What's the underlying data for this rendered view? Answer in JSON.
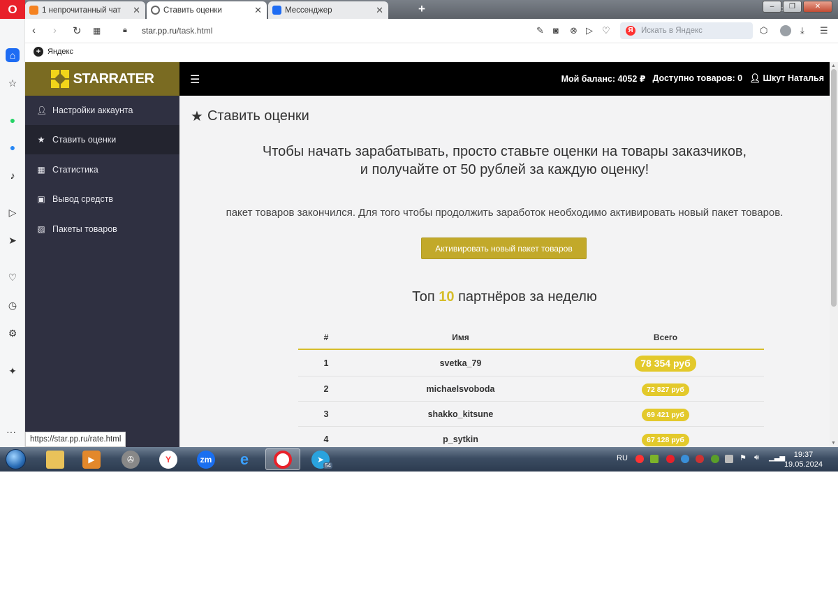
{
  "browser": {
    "tabs": [
      {
        "label": "1 непрочитанный чат",
        "icon": "chat-icon",
        "color": "#f58220"
      },
      {
        "label": "Ставить оценки",
        "icon": "globe-icon",
        "color": "#666666"
      },
      {
        "label": "Мессенджер",
        "icon": "messenger-icon",
        "color": "#1e6cf3"
      }
    ],
    "url_host": "star.pp.ru",
    "url_path": "/task.html",
    "search_placeholder": "Искать в Яндекс",
    "bookmark": "Яндекс",
    "status_url": "https://star.pp.ru/rate.html"
  },
  "brand": {
    "name": "STARRATER",
    "color": "#7a6b22",
    "accent": "#f2d51a"
  },
  "topbar": {
    "balance": "Мой баланс: 4052 ₽",
    "available": "Доступно товаров: 0",
    "user": "Шкут Наталья"
  },
  "sidebar": {
    "items": [
      {
        "label": "Настройки аккаунта",
        "icon": "user-icon"
      },
      {
        "label": "Ставить оценки",
        "icon": "star-icon"
      },
      {
        "label": "Статистика",
        "icon": "calendar-icon"
      },
      {
        "label": "Вывод средств",
        "icon": "money-icon"
      },
      {
        "label": "Пакеты товаров",
        "icon": "image-icon"
      }
    ]
  },
  "main": {
    "title": "Ставить оценки",
    "headline_line1": "Чтобы начать зарабатывать, просто ставьте оценки на товары заказчиков,",
    "headline_line2": "и получайте от 50 рублей за каждую оценку!",
    "notice": "пакет товаров закончился. Для того чтобы продолжить заработок необходимо активировать новый пакет товаров.",
    "activate_button": "Активировать новый пакет товаров",
    "top_prefix": "Топ",
    "top_number": "10",
    "top_suffix": "партнёров за неделю"
  },
  "leaderboard": {
    "columns": [
      "#",
      "Имя",
      "Всего"
    ],
    "rows": [
      {
        "rank": "1",
        "name": "svetka_79",
        "total": "78 354 руб"
      },
      {
        "rank": "2",
        "name": "michaelsvoboda",
        "total": "72 827 руб"
      },
      {
        "rank": "3",
        "name": "shakko_kitsune",
        "total": "69 421 руб"
      },
      {
        "rank": "4",
        "name": "p_sytkin",
        "total": "67 128 руб"
      }
    ]
  },
  "taskbar": {
    "lang": "RU",
    "time": "19:37",
    "date": "19.05.2024",
    "telegram_badge": "54"
  }
}
